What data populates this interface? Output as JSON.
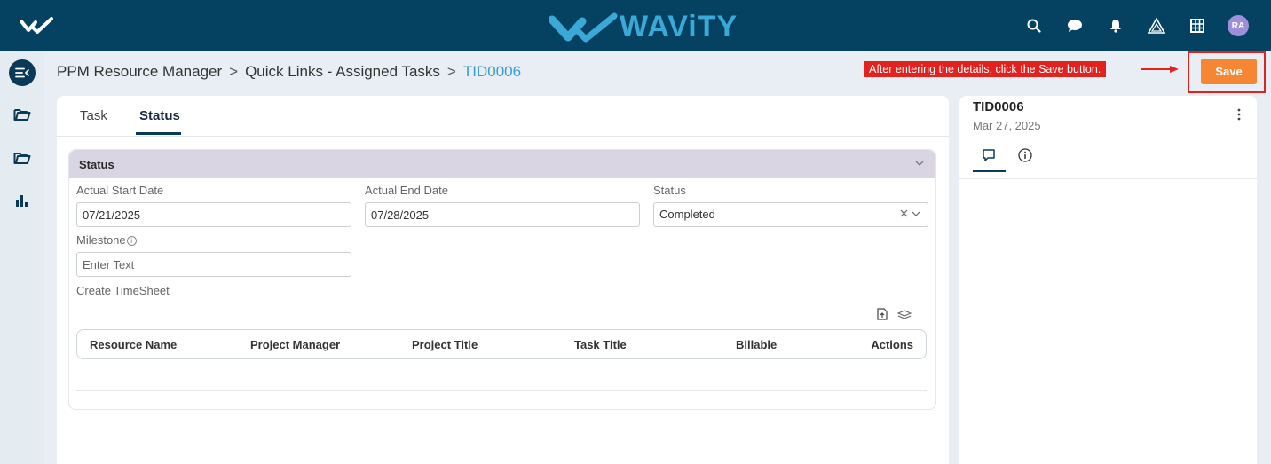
{
  "app": {
    "brand": "WAViTY"
  },
  "header": {
    "icons": [
      "search-icon",
      "chat-icon",
      "bell-icon",
      "warning-triangle-icon",
      "grid-icon"
    ],
    "avatar_initials": "RA"
  },
  "sidebar": {
    "items": [
      "collapse-menu-icon",
      "folder-icon",
      "folder-icon",
      "bar-chart-icon"
    ]
  },
  "breadcrumb": {
    "items": [
      "PPM Resource Manager",
      "Quick Links - Assigned Tasks"
    ],
    "separator": ">",
    "current": "TID0006"
  },
  "annotation": {
    "text": "After entering the details, click the Save button.",
    "color": "#e1221e"
  },
  "toolbar": {
    "save_label": "Save",
    "save_color": "#f58634"
  },
  "tabs": [
    {
      "label": "Task",
      "active": false
    },
    {
      "label": "Status",
      "active": true
    }
  ],
  "status_section": {
    "title": "Status",
    "actual_start_date": {
      "label": "Actual Start Date",
      "value": "07/21/2025"
    },
    "actual_end_date": {
      "label": "Actual End Date",
      "value": "07/28/2025"
    },
    "status": {
      "label": "Status",
      "value": "Completed"
    },
    "milestone": {
      "label": "Milestone",
      "placeholder": "Enter Text"
    },
    "create_timesheet_label": "Create TimeSheet",
    "table": {
      "columns": [
        "Resource Name",
        "Project Manager",
        "Project Title",
        "Task Title",
        "Billable",
        "Actions"
      ],
      "rows": []
    }
  },
  "right_panel": {
    "title": "TID0006",
    "date": "Mar 27, 2025",
    "tabs": [
      "comment-icon",
      "info-icon"
    ]
  },
  "colors": {
    "topbar": "#054262",
    "accent": "#3a9bd0",
    "section_header": "#d9d5e3"
  }
}
